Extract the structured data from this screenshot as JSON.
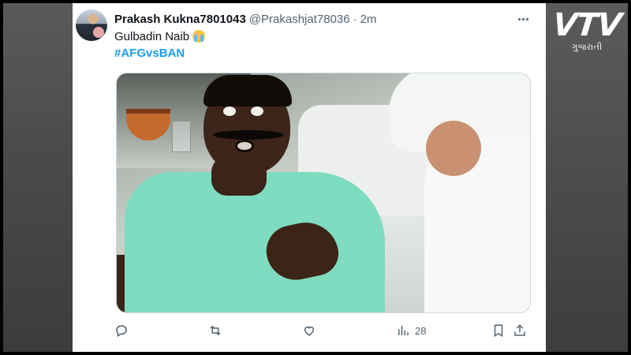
{
  "watermark": {
    "brand": "VTV",
    "subtitle": "ગુજરાતી"
  },
  "tweet": {
    "author_name": "Prakash Kukna7801043",
    "author_handle": "@Prakashjat78036",
    "separator": "·",
    "timestamp": "2m",
    "text": "Gulbadin Naib",
    "emoji": "loudly-crying-face",
    "hashtag": "#AFGvsBAN",
    "views_count": "28"
  },
  "icons": {
    "reply": "reply-icon",
    "retweet": "retweet-icon",
    "like": "heart-icon",
    "views": "views-icon",
    "bookmark": "bookmark-icon",
    "share": "share-icon",
    "more": "more-icon"
  },
  "colors": {
    "link": "#1d9bf0",
    "text_primary": "#0f1419",
    "text_secondary": "#536471",
    "background_side": "#4a4a4a"
  }
}
